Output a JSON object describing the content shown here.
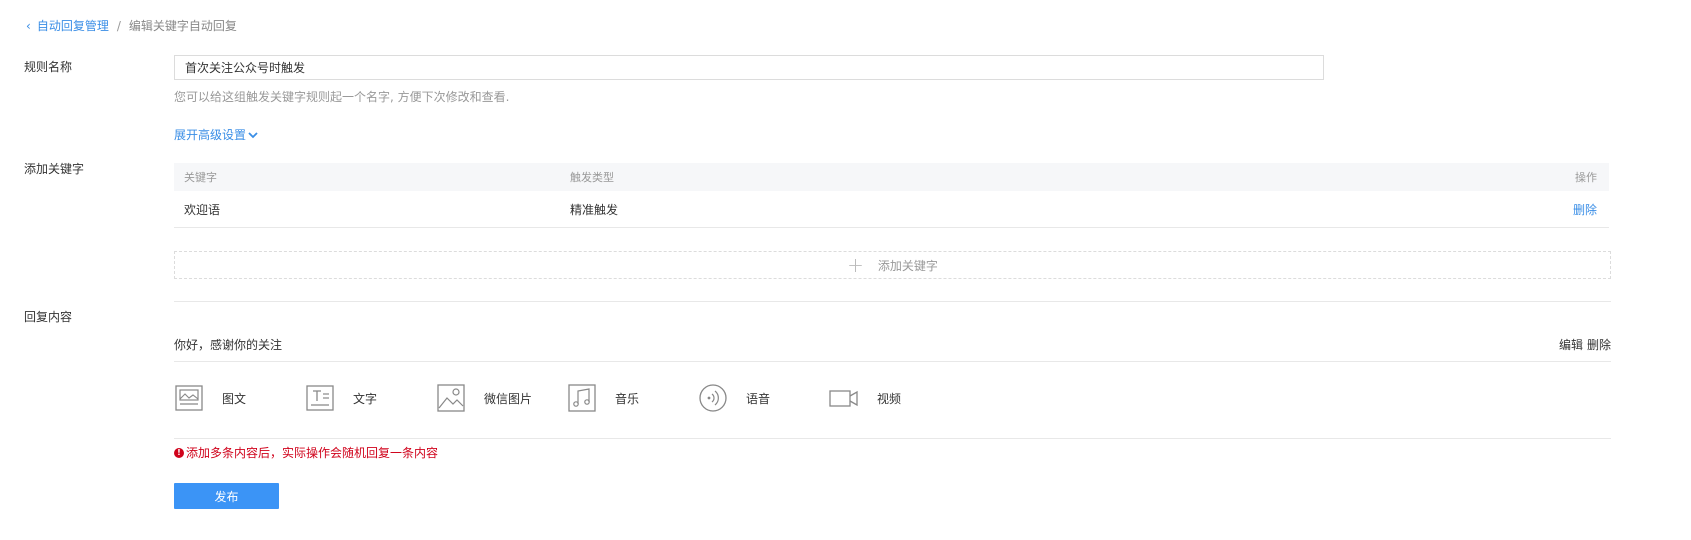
{
  "breadcrumb": {
    "parent": "自动回复管理",
    "separator": "/",
    "current": "编辑关键字自动回复"
  },
  "rule_name": {
    "label": "规则名称",
    "value": "首次关注公众号时触发",
    "hint": "您可以给这组触发关键字规则起一个名字, 方便下次修改和查看.",
    "advanced_link": "展开高级设置"
  },
  "keywords": {
    "label": "添加关键字",
    "columns": [
      "关键字",
      "触发类型",
      "操作"
    ],
    "rows": [
      {
        "keyword": "欢迎语",
        "trigger": "精准触发",
        "action": "删除"
      }
    ],
    "add_label": "添加关键字"
  },
  "reply": {
    "label": "回复内容",
    "text": "你好，感谢你的关注",
    "edit_label": "编辑",
    "delete_label": "删除",
    "types": [
      {
        "label": "图文",
        "icon": "image-text-icon"
      },
      {
        "label": "文字",
        "icon": "text-icon"
      },
      {
        "label": "微信图片",
        "icon": "picture-icon"
      },
      {
        "label": "音乐",
        "icon": "music-icon"
      },
      {
        "label": "语音",
        "icon": "voice-icon"
      },
      {
        "label": "视频",
        "icon": "video-icon"
      }
    ],
    "warning": "添加多条内容后，实际操作会随机回复一条内容"
  },
  "publish_label": "发布",
  "colors": {
    "link": "#3a8ee6",
    "primary": "#3b94f6",
    "warning": "#d0021b"
  }
}
